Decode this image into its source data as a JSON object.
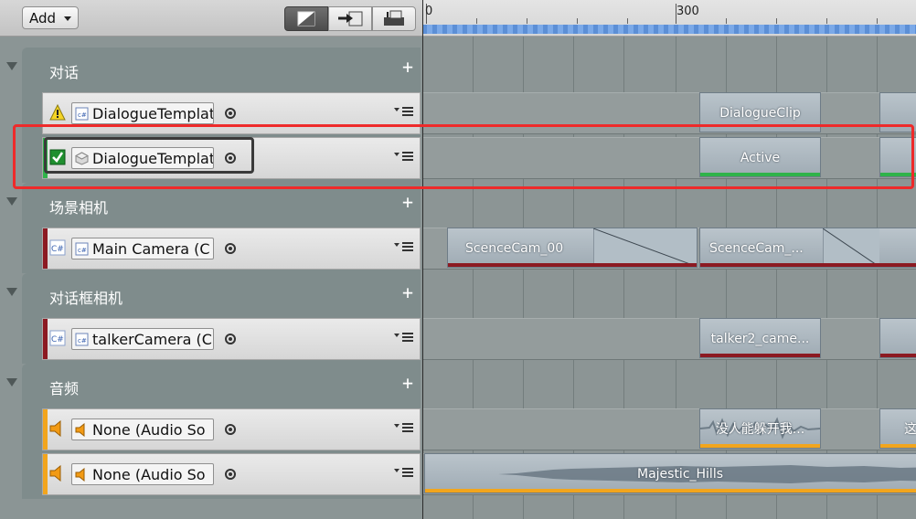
{
  "toolbar": {
    "add_label": "Add",
    "mode_buttons": [
      "clip-edit-mode-icon",
      "ripple-mode-icon",
      "replace-mode-icon"
    ]
  },
  "ruler": {
    "labels": [
      "0",
      "300"
    ]
  },
  "groups": [
    {
      "title": "对话",
      "add_symbol": "+"
    },
    {
      "title": "场景相机",
      "add_symbol": "+"
    },
    {
      "title": "对话框相机",
      "add_symbol": "+"
    },
    {
      "title": "音频",
      "add_symbol": "+"
    }
  ],
  "tracks": [
    {
      "object": "DialogueTemplate",
      "type_icon": "script-icon",
      "badge": "warning-icon",
      "stripe_color": ""
    },
    {
      "object": "DialogueTemplate",
      "type_icon": "gameobject-icon",
      "badge": "checkbox-checked-icon",
      "stripe_color": "#2fb34a"
    },
    {
      "object": "Main Camera (C",
      "type_icon": "script-icon",
      "badge": "csharp-icon",
      "stripe_color": "#8c1a22"
    },
    {
      "object": "talkerCamera (C",
      "type_icon": "script-icon",
      "badge": "csharp-icon",
      "stripe_color": "#8c1a22"
    },
    {
      "object": "None (Audio So",
      "type_icon": "speaker-icon",
      "badge": "speaker-icon",
      "stripe_color": "#f2a51d"
    },
    {
      "object": "None (Audio So",
      "type_icon": "speaker-icon",
      "badge": "speaker-icon",
      "stripe_color": "#f2a51d"
    }
  ],
  "clips": {
    "dialogue_1": "DialogueClip",
    "dialogue_2": "Active",
    "camera_1": "ScenceCam_00",
    "camera_2": "ScenceCam_...",
    "talker_1": "talker2_came...",
    "audio_1": "没人能躲开我...",
    "audio_1b": "这",
    "audio_2": "Majestic_Hills"
  },
  "colors": {
    "accent_green": "#2fb34a",
    "camera_red": "#8c1a22",
    "audio_orange": "#f2a51d",
    "highlight_red": "#ee2a2a"
  }
}
